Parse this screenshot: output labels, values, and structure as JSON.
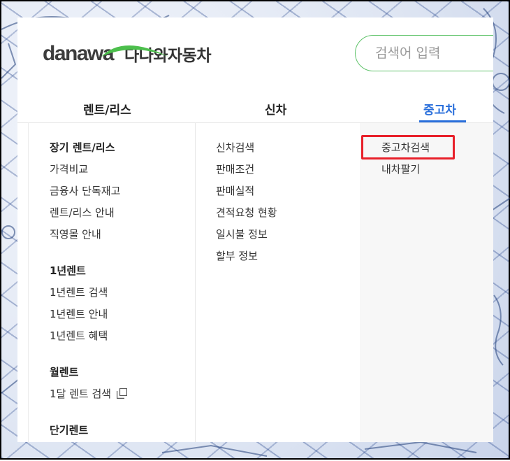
{
  "brand": {
    "logo_text": "danawa",
    "service_name": "다나와자동차",
    "swoosh_color": "#4cbf4c"
  },
  "search": {
    "placeholder": "검색어 입력",
    "border_color": "#5fc36a"
  },
  "tabs": [
    {
      "label": "렌트/리스",
      "active": false
    },
    {
      "label": "신차",
      "active": false
    },
    {
      "label": "중고차",
      "active": true
    }
  ],
  "colors": {
    "accent": "#2a6fdb",
    "highlight_box": "#e8202a"
  },
  "rent_column": {
    "groups": [
      {
        "heading": "장기 렌트/리스",
        "items": [
          "가격비교",
          "금융사 단독재고",
          "렌트/리스 안내",
          "직영몰 안내"
        ]
      },
      {
        "heading": "1년렌트",
        "items": [
          "1년렌트 검색",
          "1년렌트 안내",
          "1년렌트 혜택"
        ]
      },
      {
        "heading": "월렌트",
        "items": [
          "1달 렌트 검색"
        ]
      },
      {
        "heading": "단기렌트",
        "items": []
      }
    ],
    "external_link_icon": "external-link-icon"
  },
  "newcar_column": {
    "items": [
      "신차검색",
      "판매조건",
      "판매실적",
      "견적요청 현황",
      "일시불 정보",
      "할부 정보"
    ]
  },
  "usedcar_column": {
    "items": [
      "중고차검색",
      "내차팔기"
    ]
  }
}
